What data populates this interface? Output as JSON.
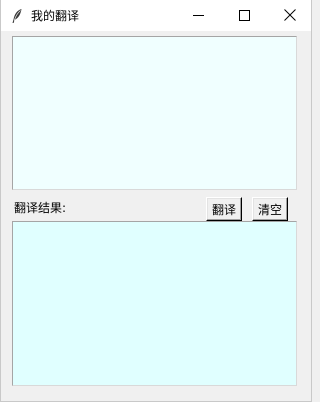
{
  "window": {
    "title": "我的翻译",
    "app_icon": "feather-icon",
    "controls": {
      "minimize_icon": "minimize-icon",
      "maximize_icon": "maximize-icon",
      "close_icon": "close-icon"
    }
  },
  "main": {
    "input_text": "",
    "result_label": "翻译结果:",
    "translate_button": "翻译",
    "clear_button": "清空",
    "result_text": ""
  },
  "colors": {
    "input_bg": "#f0ffff",
    "result_bg": "#e0ffff",
    "window_bg": "#f0f0f0"
  }
}
